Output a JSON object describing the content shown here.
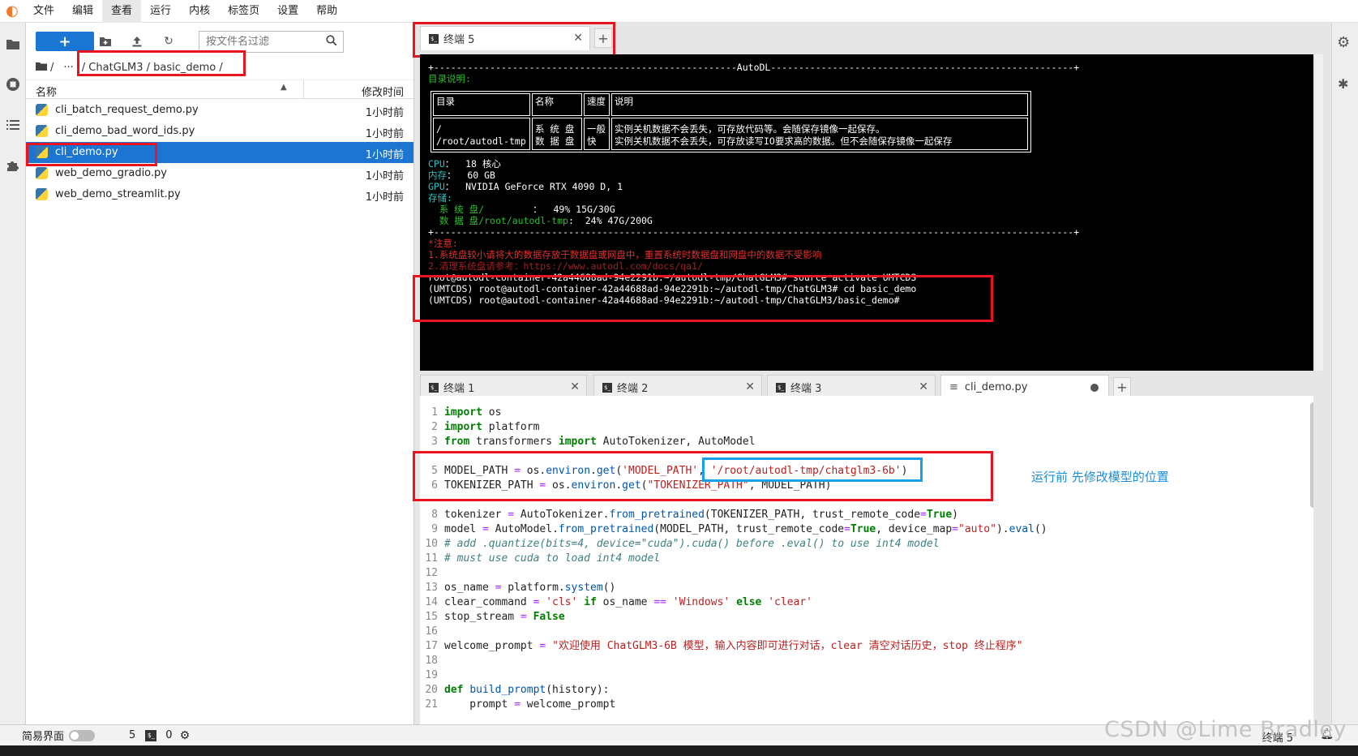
{
  "menu": [
    "文件",
    "编辑",
    "查看",
    "运行",
    "内核",
    "标签页",
    "设置",
    "帮助"
  ],
  "menu_active_index": 2,
  "file_browser": {
    "new_button": "+",
    "filter_placeholder": "按文件名过滤",
    "breadcrumb_root": "/",
    "breadcrumb_ellipsis": "···",
    "breadcrumb_path": "/ ChatGLM3 / basic_demo /",
    "col_name": "名称",
    "col_modified": "修改时间",
    "files": [
      {
        "name": "cli_batch_request_demo.py",
        "modified": "1小时前"
      },
      {
        "name": "cli_demo_bad_word_ids.py",
        "modified": "1小时前"
      },
      {
        "name": "cli_demo.py",
        "modified": "1小时前",
        "selected": true
      },
      {
        "name": "web_demo_gradio.py",
        "modified": "1小时前"
      },
      {
        "name": "web_demo_streamlit.py",
        "modified": "1小时前"
      }
    ]
  },
  "top_tabs": [
    {
      "label": "终端 5"
    }
  ],
  "terminal": {
    "rule_top": "+------------------------------------------------------AutoDL------------------------------------------------------+",
    "dir_desc": "目录说明:",
    "table": {
      "h1": "目录",
      "h2": "名称",
      "h3": "速度",
      "h4": "说明",
      "r1c1": "/",
      "r1c2": "系 统 盘",
      "r1c3": "一般",
      "r1c4": "实例关机数据不会丢失，可存放代码等。会随保存镜像一起保存。",
      "r2c1": "/root/autodl-tmp",
      "r2c2": "数 据 盘",
      "r2c3": "快",
      "r2c4": "实例关机数据不会丢失，可存放读写IO要求高的数据。但不会随保存镜像一起保存"
    },
    "cpu_label": "CPU",
    "cpu_value": "：  18 核心",
    "mem_label": "内存",
    "mem_value": "：  60 GB",
    "gpu_label": "GPU",
    "gpu_value": "：  NVIDIA GeForce RTX 4090 D, 1",
    "storage_label": "存储:",
    "sys_disk_label": "  系 统 盘/",
    "sys_disk_value": "：  49% 15G/30G",
    "data_disk_label": "  数 据 盘/root/autodl-tmp",
    "data_disk_value": ":  24% 47G/200G",
    "rule_bottom": "+------------------------------------------------------------------------------------------------------------------+",
    "note_title": "*注意:",
    "note_1": "1.系统盘较小请将大的数据存放于数据盘或网盘中，重置系统时数据盘和网盘中的数据不受影响",
    "note_2": "2.清理系统盘请参考：https://www.autodl.com/docs/qa1/",
    "cmd_1": "root@autodl-container-42a44688ad-94e2291b:~/autodl-tmp/ChatGLM3# source activate UMTCDS",
    "cmd_2": "(UMTCDS) root@autodl-container-42a44688ad-94e2291b:~/autodl-tmp/ChatGLM3# cd basic_demo",
    "cmd_3": "(UMTCDS) root@autodl-container-42a44688ad-94e2291b:~/autodl-tmp/ChatGLM3/basic_demo#"
  },
  "bottom_tabs": [
    {
      "label": "终端 1"
    },
    {
      "label": "终端 2"
    },
    {
      "label": "终端 3"
    },
    {
      "label": "cli_demo.py"
    }
  ],
  "code": {
    "l1": "1",
    "l2": "2",
    "l3": "3",
    "l5": "5",
    "l6": "6",
    "l8": "8",
    "l9": "9",
    "l10": "10",
    "l11": "11",
    "l12": "12",
    "l13": "13",
    "l14": "14",
    "l15": "15",
    "l16": "16",
    "l17": "17",
    "l18": "18",
    "l19": "19",
    "l20": "20",
    "l21": "21",
    "model_path_str": "'/root/autodl-tmp/chatglm3-6b'",
    "welcome_str": "\"欢迎使用 ChatGLM3-6B 模型，输入内容即可进行对话，clear 清空对话历史，stop 终止程序\""
  },
  "annotation": "运行前 先修改模型的位置",
  "status": {
    "simple_mode": "简易界面",
    "count_terminals": "5",
    "count_kernels": "0",
    "right_label": "终端 5"
  },
  "watermark": "CSDN @Lime Bradley",
  "colors": {
    "accent": "#1976d2",
    "highlight_red": "#e8141f",
    "highlight_blue": "#18a0e8"
  }
}
